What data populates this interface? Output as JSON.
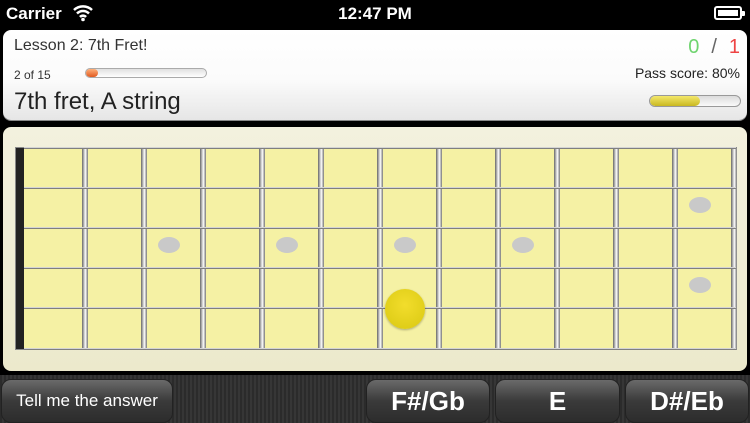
{
  "status_bar": {
    "carrier": "Carrier",
    "time": "12:47 PM"
  },
  "header": {
    "lesson_title": "Lesson 2: 7th Fret!",
    "score_correct": "0",
    "score_slash": "/",
    "score_wrong": "1",
    "progress_text": "2 of 15",
    "progress_fraction": 0.1,
    "pass_score": "Pass score: 80%",
    "pass_fraction": 0.55,
    "question": "7th fret, A string"
  },
  "buttons": {
    "tell_me": "Tell me the answer",
    "answers": [
      "F#/Gb",
      "E",
      "D#/Eb"
    ]
  },
  "colors": {
    "correct": "#6fd46f",
    "wrong": "#e44444",
    "target": "#e2d21c",
    "board": "#f5f1a4"
  }
}
